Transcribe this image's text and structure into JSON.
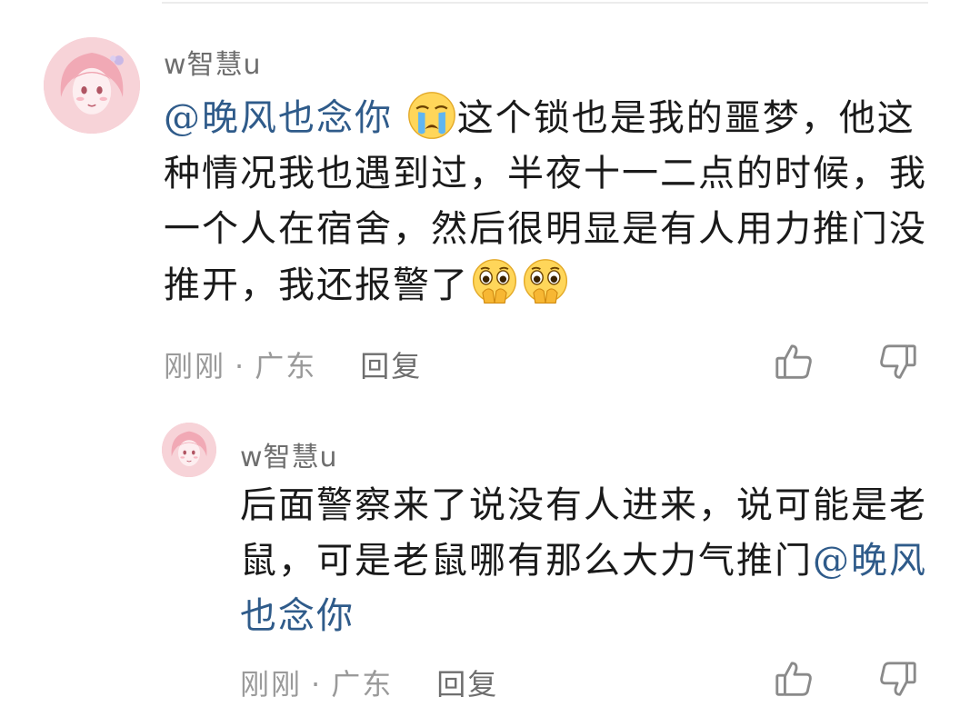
{
  "comment": {
    "username": "w智慧u",
    "mention": "@晚风也念你",
    "text": "这个锁也是我的噩梦，他这种情况我也遇到过，半夜十一二点的时候，我一个人在宿舍，然后很明显是有人用力推门没推开，我还报警了",
    "emojis": [
      "crying-face-emoji",
      "pleading-hands-emoji",
      "pleading-hands-emoji"
    ],
    "time": "刚刚",
    "separator": "·",
    "location": "广东",
    "reply_label": "回复",
    "icons": {
      "like": "thumbs-up-icon",
      "dislike": "thumbs-down-icon"
    }
  },
  "reply": {
    "username": "w智慧u",
    "text": "后面警察来了说没有人进来，说可能是老鼠，可是老鼠哪有那么大力气推门",
    "mention": "@晚风也念你",
    "time": "刚刚",
    "separator": "·",
    "location": "广东",
    "reply_label": "回复",
    "icons": {
      "like": "thumbs-up-icon",
      "dislike": "thumbs-down-icon"
    }
  },
  "colors": {
    "mention": "#2f5b8a",
    "meta": "#9a9a9a",
    "username": "#6e6e6e",
    "text": "#1a1a1a"
  }
}
